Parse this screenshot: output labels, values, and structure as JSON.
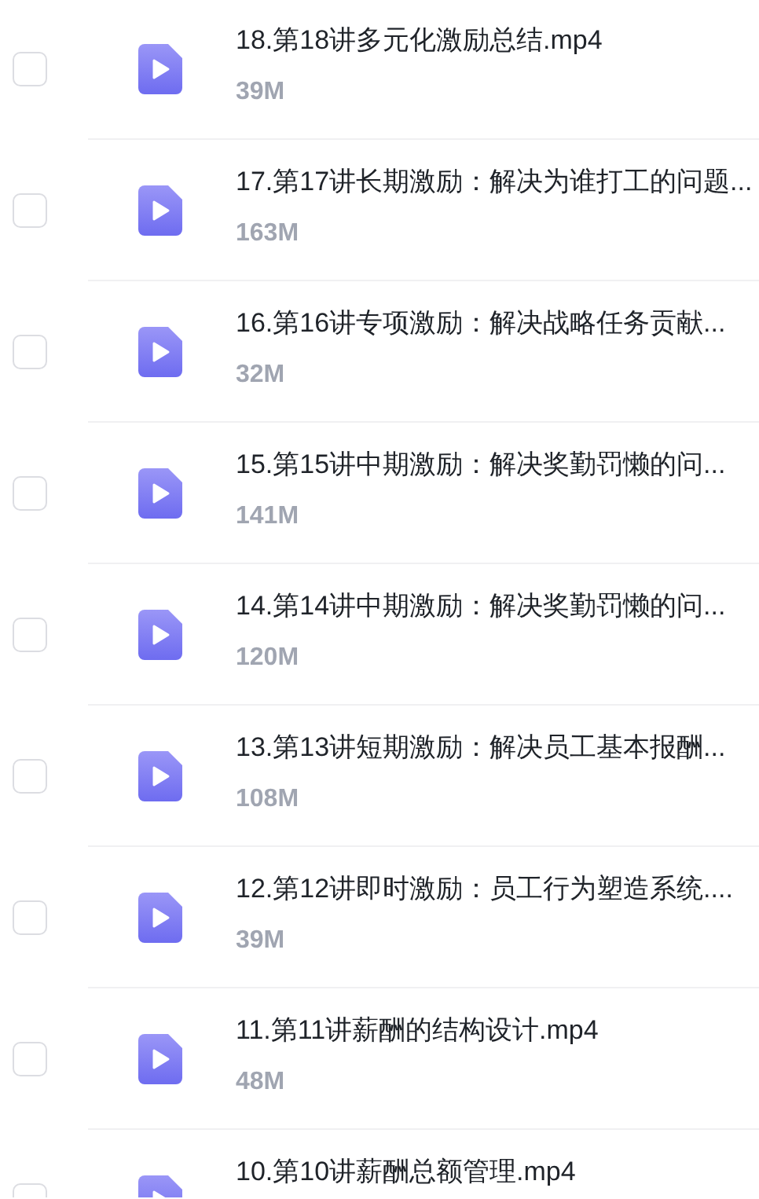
{
  "files": [
    {
      "name": "18.第18讲多元化激励总结.mp4",
      "size": "39M",
      "checked": false
    },
    {
      "name": "17.第17讲长期激励：解决为谁打工的问题...",
      "size": "163M",
      "checked": false
    },
    {
      "name": "16.第16讲专项激励：解决战略任务贡献...",
      "size": "32M",
      "checked": false
    },
    {
      "name": "15.第15讲中期激励：解决奖勤罚懒的问...",
      "size": "141M",
      "checked": false
    },
    {
      "name": "14.第14讲中期激励：解决奖勤罚懒的问...",
      "size": "120M",
      "checked": false
    },
    {
      "name": "13.第13讲短期激励：解决员工基本报酬...",
      "size": "108M",
      "checked": false
    },
    {
      "name": "12.第12讲即时激励：员工行为塑造系统....",
      "size": "39M",
      "checked": false
    },
    {
      "name": "11.第11讲薪酬的结构设计.mp4",
      "size": "48M",
      "checked": false
    },
    {
      "name": "10.第10讲薪酬总额管理.mp4",
      "checked": false
    }
  ]
}
